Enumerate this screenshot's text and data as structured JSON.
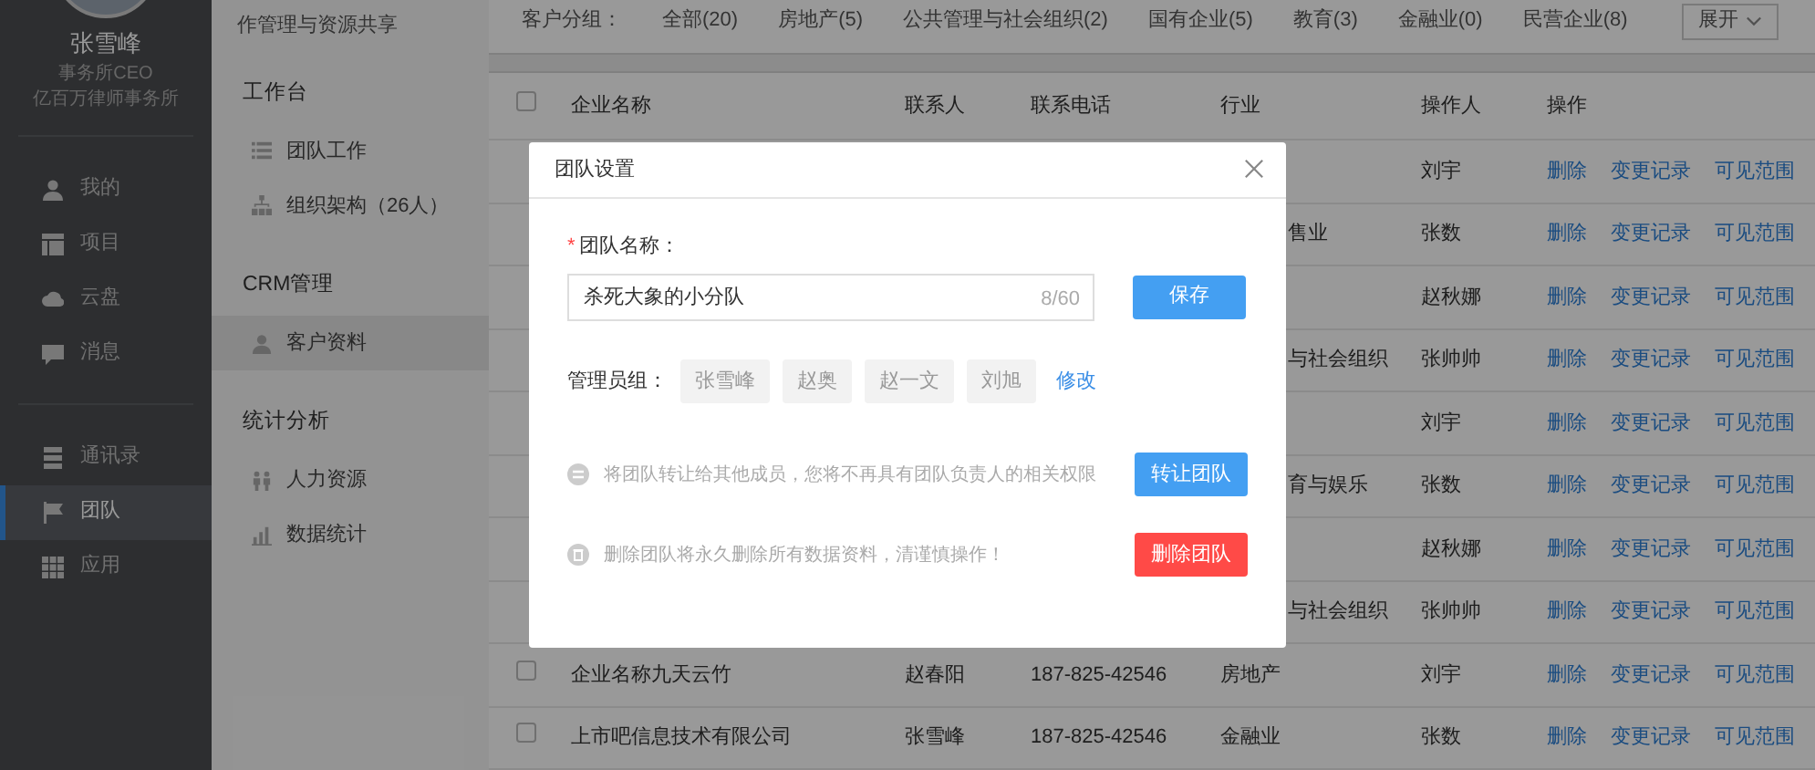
{
  "sidebar": {
    "profile": {
      "name": "张雪峰",
      "title": "事务所CEO",
      "company": "亿百万律师事务所"
    },
    "nav_groups": [
      [
        {
          "label": "我的",
          "selected": false
        },
        {
          "label": "项目",
          "selected": false
        },
        {
          "label": "云盘",
          "selected": false
        },
        {
          "label": "消息",
          "selected": false
        }
      ],
      [
        {
          "label": "通讯录",
          "selected": false
        },
        {
          "label": "团队",
          "selected": true
        },
        {
          "label": "应用",
          "selected": false
        }
      ]
    ]
  },
  "subnav": {
    "intro": "作管理与资源共享",
    "sections": [
      {
        "title": "工作台",
        "items": [
          {
            "label": "团队工作",
            "selected": false
          },
          {
            "label": "组织架构（26人）",
            "selected": false
          }
        ]
      },
      {
        "title": "CRM管理",
        "items": [
          {
            "label": "客户资料",
            "selected": true
          }
        ]
      },
      {
        "title": "统计分析",
        "items": [
          {
            "label": "人力资源",
            "selected": false
          },
          {
            "label": "数据统计",
            "selected": false
          }
        ]
      }
    ]
  },
  "filter_bar": {
    "label": "客户分组：",
    "groups": [
      "全部(20)",
      "房地产(5)",
      "公共管理与社会组织(2)",
      "国有企业(5)",
      "教育(3)",
      "金融业(0)",
      "民营企业(8)"
    ],
    "expand_button": "展开"
  },
  "table": {
    "header_checkbox": {
      "checked": false
    },
    "columns": [
      "企业名称",
      "联系人",
      "联系电话",
      "行业",
      "操作人",
      "操作"
    ],
    "rows": [
      {
        "operator": "刘宇",
        "actions": [
          "删除",
          "变更记录",
          "可见范围"
        ]
      },
      {
        "industry": "售业",
        "operator": "张数",
        "actions": [
          "删除",
          "变更记录",
          "可见范围"
        ]
      },
      {
        "operator": "赵秋娜",
        "actions": [
          "删除",
          "变更记录",
          "可见范围"
        ]
      },
      {
        "industry": "与社会组织",
        "operator": "张帅帅",
        "actions": [
          "删除",
          "变更记录",
          "可见范围"
        ]
      },
      {
        "operator": "刘宇",
        "actions": [
          "删除",
          "变更记录",
          "可见范围"
        ]
      },
      {
        "industry": "育与娱乐",
        "operator": "张数",
        "actions": [
          "删除",
          "变更记录",
          "可见范围"
        ]
      },
      {
        "operator": "赵秋娜",
        "actions": [
          "删除",
          "变更记录",
          "可见范围"
        ]
      },
      {
        "industry": "与社会组织",
        "operator": "张帅帅",
        "actions": [
          "删除",
          "变更记录",
          "可见范围"
        ]
      },
      {
        "checked": false,
        "company": "企业名称九天云竹",
        "contact": "赵春阳",
        "phone": "187-825-42546",
        "industry": "房地产",
        "operator": "刘宇",
        "actions": [
          "删除",
          "变更记录",
          "可见范围"
        ]
      },
      {
        "checked": false,
        "company": "上市吧信息技术有限公司",
        "contact": "张雪峰",
        "phone": "187-825-42546",
        "industry": "金融业",
        "operator": "张数",
        "actions": [
          "删除",
          "变更记录",
          "可见范围"
        ]
      }
    ]
  },
  "modal": {
    "title": "团队设置",
    "team_name": {
      "required_mark": "*",
      "label": "团队名称：",
      "value": "杀死大象的小分队",
      "counter": "8/60"
    },
    "save_button": "保存",
    "admins": {
      "label": "管理员组：",
      "members": [
        "张雪峰",
        "赵奥",
        "赵一文",
        "刘旭"
      ],
      "edit_link": "修改"
    },
    "transfer": {
      "text": "将团队转让给其他成员，您将不再具有团队负责人的相关权限",
      "button": "转让团队"
    },
    "delete": {
      "text": "删除团队将永久删除所有数据资料，清谨慎操作！",
      "button": "删除团队"
    }
  }
}
